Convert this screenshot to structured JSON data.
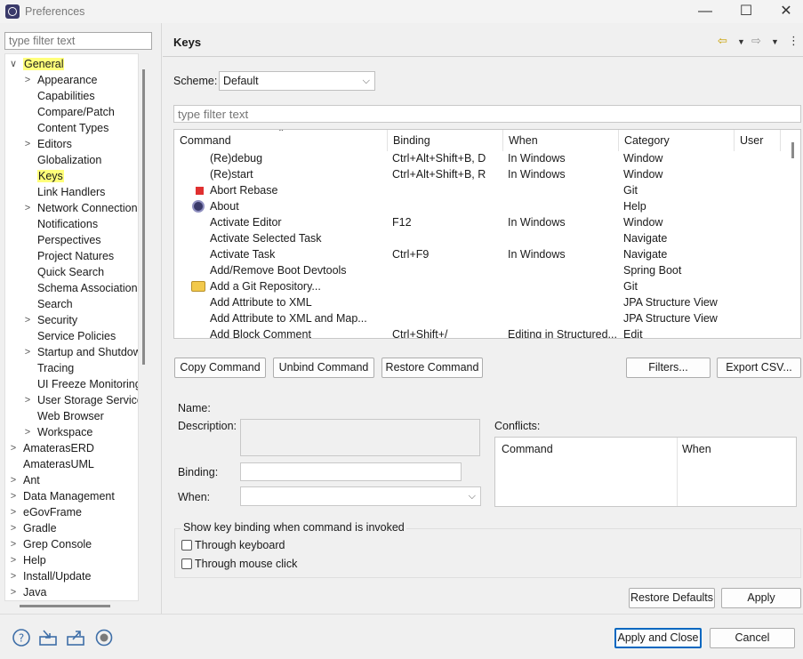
{
  "window": {
    "title": "Preferences",
    "minimize": "—",
    "maximize": "☐",
    "close": "✕"
  },
  "left": {
    "filter_placeholder": "type filter text",
    "tree": [
      {
        "label": "General",
        "chevron": "∨",
        "highlight": true,
        "indent": 0
      },
      {
        "label": "Appearance",
        "chevron": ">",
        "indent": 1
      },
      {
        "label": "Capabilities",
        "indent": 1
      },
      {
        "label": "Compare/Patch",
        "indent": 1
      },
      {
        "label": "Content Types",
        "indent": 1
      },
      {
        "label": "Editors",
        "chevron": ">",
        "indent": 1
      },
      {
        "label": "Globalization",
        "indent": 1
      },
      {
        "label": "Keys",
        "highlight": true,
        "indent": 1
      },
      {
        "label": "Link Handlers",
        "indent": 1
      },
      {
        "label": "Network Connection",
        "chevron": ">",
        "indent": 1
      },
      {
        "label": "Notifications",
        "indent": 1
      },
      {
        "label": "Perspectives",
        "indent": 1
      },
      {
        "label": "Project Natures",
        "indent": 1
      },
      {
        "label": "Quick Search",
        "indent": 1
      },
      {
        "label": "Schema Associations",
        "indent": 1
      },
      {
        "label": "Search",
        "indent": 1
      },
      {
        "label": "Security",
        "chevron": ">",
        "indent": 1
      },
      {
        "label": "Service Policies",
        "indent": 1
      },
      {
        "label": "Startup and Shutdow",
        "chevron": ">",
        "indent": 1
      },
      {
        "label": "Tracing",
        "indent": 1
      },
      {
        "label": "UI Freeze Monitoring",
        "indent": 1
      },
      {
        "label": "User Storage Service",
        "chevron": ">",
        "indent": 1
      },
      {
        "label": "Web Browser",
        "indent": 1
      },
      {
        "label": "Workspace",
        "chevron": ">",
        "indent": 1
      },
      {
        "label": "AmaterasERD",
        "chevron": ">",
        "indent": 0
      },
      {
        "label": "AmaterasUML",
        "indent": 0
      },
      {
        "label": "Ant",
        "chevron": ">",
        "indent": 0
      },
      {
        "label": "Data Management",
        "chevron": ">",
        "indent": 0
      },
      {
        "label": "eGovFrame",
        "chevron": ">",
        "indent": 0
      },
      {
        "label": "Gradle",
        "chevron": ">",
        "indent": 0
      },
      {
        "label": "Grep Console",
        "chevron": ">",
        "indent": 0
      },
      {
        "label": "Help",
        "chevron": ">",
        "indent": 0
      },
      {
        "label": "Install/Update",
        "chevron": ">",
        "indent": 0
      },
      {
        "label": "Java",
        "chevron": ">",
        "indent": 0
      }
    ]
  },
  "right": {
    "title": "Keys",
    "scheme_label": "Scheme:",
    "scheme_value": "Default",
    "filter_placeholder": "type filter text",
    "columns": [
      "Command",
      "Binding",
      "When",
      "Category",
      "User"
    ],
    "rows": [
      {
        "command": "(Re)debug",
        "binding": "Ctrl+Alt+Shift+B, D",
        "when": "In Windows",
        "category": "Window",
        "icon": ""
      },
      {
        "command": "(Re)start",
        "binding": "Ctrl+Alt+Shift+B, R",
        "when": "In Windows",
        "category": "Window",
        "icon": ""
      },
      {
        "command": "Abort Rebase",
        "binding": "",
        "when": "",
        "category": "Git",
        "icon": "stop-icon"
      },
      {
        "command": "About",
        "binding": "",
        "when": "",
        "category": "Help",
        "icon": "eclipse-icon"
      },
      {
        "command": "Activate Editor",
        "binding": "F12",
        "when": "In Windows",
        "category": "Window",
        "icon": ""
      },
      {
        "command": "Activate Selected Task",
        "binding": "",
        "when": "",
        "category": "Navigate",
        "icon": ""
      },
      {
        "command": "Activate Task",
        "binding": "Ctrl+F9",
        "when": "In Windows",
        "category": "Navigate",
        "icon": ""
      },
      {
        "command": "Add/Remove Boot Devtools",
        "binding": "",
        "when": "",
        "category": "Spring Boot",
        "icon": ""
      },
      {
        "command": "Add a Git Repository...",
        "binding": "",
        "when": "",
        "category": "Git",
        "icon": "git-repo-icon"
      },
      {
        "command": "Add Attribute to XML",
        "binding": "",
        "when": "",
        "category": "JPA Structure View",
        "icon": ""
      },
      {
        "command": "Add Attribute to XML and Map...",
        "binding": "",
        "when": "",
        "category": "JPA Structure View",
        "icon": ""
      },
      {
        "command": "Add Block Comment",
        "binding": "Ctrl+Shift+/",
        "when": "Editing in Structured...",
        "category": "Edit",
        "icon": ""
      }
    ],
    "buttons": {
      "copy": "Copy Command",
      "unbind": "Unbind Command",
      "restore": "Restore Command",
      "filters": "Filters...",
      "export": "Export CSV..."
    },
    "details": {
      "name_label": "Name:",
      "description_label": "Description:",
      "binding_label": "Binding:",
      "when_label": "When:",
      "conflicts_label": "Conflicts:",
      "conflict_columns": [
        "Command",
        "When"
      ]
    },
    "show_group": {
      "title": "Show key binding when command is invoked",
      "keyboard": "Through keyboard",
      "mouse": "Through mouse click"
    },
    "restore_defaults": "Restore Defaults",
    "apply": "Apply"
  },
  "footer": {
    "apply_close": "Apply and Close",
    "cancel": "Cancel",
    "icons": [
      "help-icon",
      "import-icon",
      "export-icon",
      "record-icon"
    ]
  },
  "colors": {
    "highlight": "#ffff7a",
    "accent": "#0067c0",
    "stop": "#e03030"
  }
}
